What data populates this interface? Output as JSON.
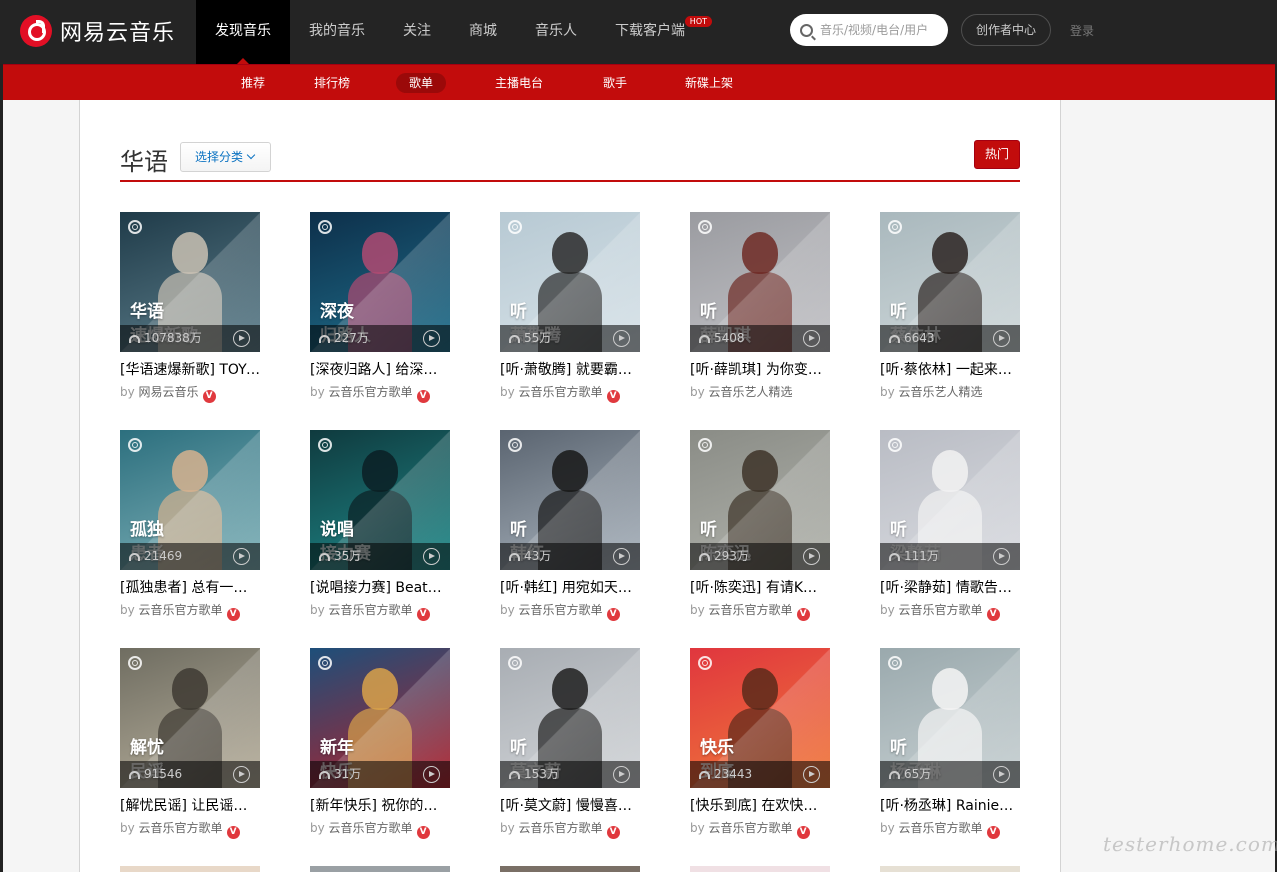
{
  "topbar": {
    "logo_text": "网易云音乐",
    "nav": [
      {
        "label": "发现音乐",
        "active": true
      },
      {
        "label": "我的音乐"
      },
      {
        "label": "关注"
      },
      {
        "label": "商城"
      },
      {
        "label": "音乐人"
      },
      {
        "label": "下载客户端",
        "badge": "HOT"
      }
    ],
    "search_placeholder": "音乐/视频/电台/用户",
    "creator_center": "创作者中心",
    "login": "登录"
  },
  "subnav": [
    {
      "label": "推荐"
    },
    {
      "label": "排行榜"
    },
    {
      "label": "歌单",
      "active": true
    },
    {
      "label": "主播电台"
    },
    {
      "label": "歌手"
    },
    {
      "label": "新碟上架"
    }
  ],
  "category": {
    "title": "华语",
    "select_label": "选择分类",
    "hot_button": "热门"
  },
  "by_prefix": "by",
  "verified_badge": "V",
  "playlists": [
    {
      "cover_line1": "华语",
      "cover_line2": "速爆新歌",
      "plays": "107838万",
      "title": "[华语速爆新歌] TOYO…",
      "creator": "网易云音乐",
      "verified": true,
      "colors": [
        "#1f3b49",
        "#5e7f8c",
        "#c9c1b3"
      ]
    },
    {
      "cover_line1": "深夜",
      "cover_line2": "归路人",
      "plays": "227万",
      "title": "[深夜归路人] 给深夜…",
      "creator": "云音乐官方歌单",
      "verified": true,
      "colors": [
        "#0d2f4a",
        "#1f6f8c",
        "#b04a72"
      ]
    },
    {
      "cover_line1": "听",
      "cover_line2": "萧敬腾",
      "plays": "55万",
      "title": "[听·萧敬腾] 就要霸…",
      "creator": "云音乐官方歌单",
      "verified": true,
      "colors": [
        "#b7c9d3",
        "#d7e2e8",
        "#2a2a2a"
      ]
    },
    {
      "cover_line1": "听",
      "cover_line2": "薛凯琪",
      "plays": "5408",
      "title": "[听·薛凯琪] 为你变…",
      "creator": "云音乐艺人精选",
      "verified": false,
      "colors": [
        "#9a9ba0",
        "#c2c2c6",
        "#6e2a24"
      ]
    },
    {
      "cover_line1": "听",
      "cover_line2": "蔡依林",
      "plays": "6643",
      "title": "[听·蔡依林] 一起来…",
      "creator": "云音乐艺人精选",
      "verified": false,
      "colors": [
        "#a9b8bd",
        "#cfd8da",
        "#2c2321"
      ]
    },
    {
      "cover_line1": "孤独",
      "cover_line2": "患者",
      "plays": "21469",
      "title": "[孤独患者] 总有一首…",
      "creator": "云音乐官方歌单",
      "verified": true,
      "colors": [
        "#2c6f7e",
        "#7fb1b8",
        "#d6b28e"
      ]
    },
    {
      "cover_line1": "说唱",
      "cover_line2": "接力赛",
      "plays": "35万",
      "title": "[说唱接力赛] Beat唱…",
      "creator": "云音乐官方歌单",
      "verified": true,
      "colors": [
        "#0f3a3e",
        "#1f8a8a",
        "#0b1f24"
      ]
    },
    {
      "cover_line1": "听",
      "cover_line2": "韩红",
      "plays": "43万",
      "title": "[听·韩红] 用宛如天…",
      "creator": "云音乐官方歌单",
      "verified": true,
      "colors": [
        "#5a6470",
        "#a9b3bd",
        "#181818"
      ]
    },
    {
      "cover_line1": "听",
      "cover_line2": "陈奕迅",
      "plays": "293万",
      "title": "[听·陈奕迅] 有请K歌…",
      "creator": "云音乐官方歌单",
      "verified": true,
      "colors": [
        "#8a8c86",
        "#b1b3ac",
        "#3d3328"
      ]
    },
    {
      "cover_line1": "听",
      "cover_line2": "梁静茹",
      "plays": "111万",
      "title": "[听·梁静茹] 情歌告…",
      "creator": "云音乐官方歌单",
      "verified": true,
      "colors": [
        "#b9bcc4",
        "#d9dbe0",
        "#f2f2f2"
      ]
    },
    {
      "cover_line1": "解忧",
      "cover_line2": "民谣",
      "plays": "91546",
      "title": "[解忧民谣] 让民谣带…",
      "creator": "云音乐官方歌单",
      "verified": true,
      "colors": [
        "#6f6d61",
        "#b8b09d",
        "#3e3a33"
      ]
    },
    {
      "cover_line1": "新年",
      "cover_line2": "快乐",
      "plays": "31万",
      "title": "[新年快乐] 祝你的兔…",
      "creator": "云音乐官方歌单",
      "verified": true,
      "colors": [
        "#1d4f7a",
        "#b3202a",
        "#d9a24a"
      ]
    },
    {
      "cover_line1": "听",
      "cover_line2": "莫文蔚",
      "plays": "153万",
      "title": "[听·莫文蔚] 慢慢喜…",
      "creator": "云音乐官方歌单",
      "verified": true,
      "colors": [
        "#a8adb3",
        "#d2d5d8",
        "#1f1f1f"
      ]
    },
    {
      "cover_line1": "快乐",
      "cover_line2": "到底",
      "plays": "23443",
      "title": "[快乐到底] 在欢快的…",
      "creator": "云音乐官方歌单",
      "verified": true,
      "colors": [
        "#e0363e",
        "#f07a3a",
        "#5a2a1a"
      ]
    },
    {
      "cover_line1": "听",
      "cover_line2": "杨丞琳",
      "plays": "65万",
      "title": "[听·杨丞琳] Rainie…",
      "creator": "云音乐官方歌单",
      "verified": true,
      "colors": [
        "#9aa9ad",
        "#c7d0d2",
        "#f4f4f4"
      ]
    }
  ],
  "watermark": "testerhome.com"
}
